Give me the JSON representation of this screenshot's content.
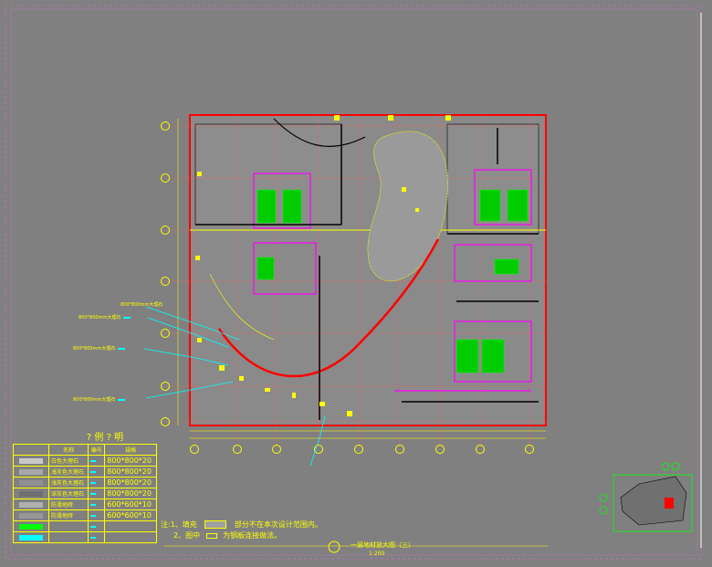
{
  "legend": {
    "title": "? 例 ? 明",
    "headers": [
      "",
      "名称",
      "编号",
      "规格"
    ],
    "rows": [
      {
        "name": "白色大理石",
        "code": "",
        "spec": "800*800*20",
        "color": "#c8c8c8"
      },
      {
        "name": "浅灰色大理石",
        "code": "",
        "spec": "800*800*20",
        "color": "#a8a8a8"
      },
      {
        "name": "浅灰色大理石",
        "code": "",
        "spec": "800*800*20",
        "color": "#909090"
      },
      {
        "name": "深灰色大理石",
        "code": "",
        "spec": "800*800*20",
        "color": "#707070"
      },
      {
        "name": "防滑地砖",
        "code": "",
        "spec": "600*600*10",
        "color": "#b0b0b0"
      },
      {
        "name": "防滑地砖",
        "code": "",
        "spec": "600*600*10",
        "color": "#989898"
      },
      {
        "name": "",
        "code": "",
        "spec": "",
        "color": "#00ff00"
      },
      {
        "name": "",
        "code": "",
        "spec": "",
        "color": "#00ffff"
      }
    ]
  },
  "notes": {
    "line1_prefix": "注:1、填充",
    "line1_text": "部分不在本次设计范围内。",
    "line2_prefix": "2、图中",
    "line2_text": "为钢板连接做法。"
  },
  "callouts": [
    {
      "text": "800*800mm大理石",
      "tag": ""
    },
    {
      "text": "800*800mm大理石",
      "tag": ""
    },
    {
      "text": "800*800mm大理石",
      "tag": ""
    },
    {
      "text": "800*800mm大理石",
      "tag": ""
    }
  ],
  "title": {
    "main": "一层地材放大图（三）",
    "scale": "1:200"
  },
  "colors": {
    "background": "#808080",
    "walls": "#ff0000",
    "axis": "#ffff00",
    "stairs": "#00ff00",
    "rooms": "#ff00ff",
    "leader": "#00ffff"
  }
}
